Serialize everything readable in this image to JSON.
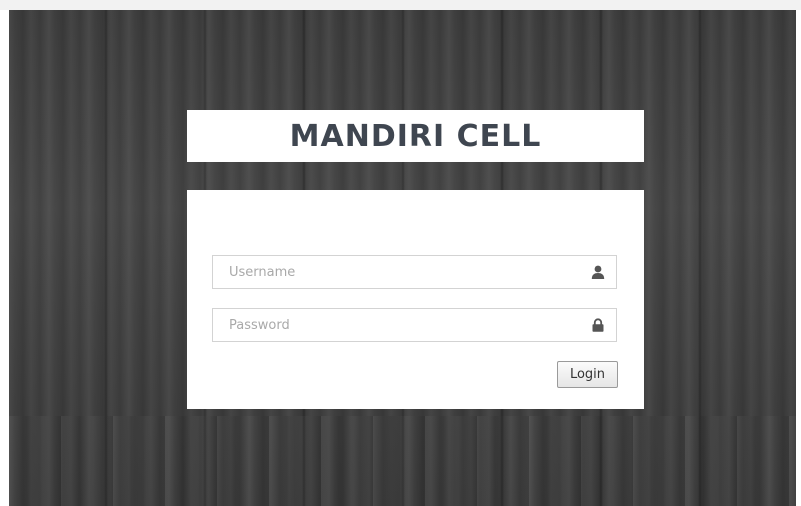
{
  "header": {
    "title": "MANDIRI CELL"
  },
  "login_form": {
    "username": {
      "placeholder": "Username",
      "value": "",
      "icon": "user-icon"
    },
    "password": {
      "placeholder": "Password",
      "value": "",
      "icon": "lock-icon"
    },
    "submit_label": "Login"
  },
  "colors": {
    "title_text": "#3f4650",
    "background": "#404040",
    "panel": "#ffffff",
    "field_border": "#d3d3d3"
  }
}
